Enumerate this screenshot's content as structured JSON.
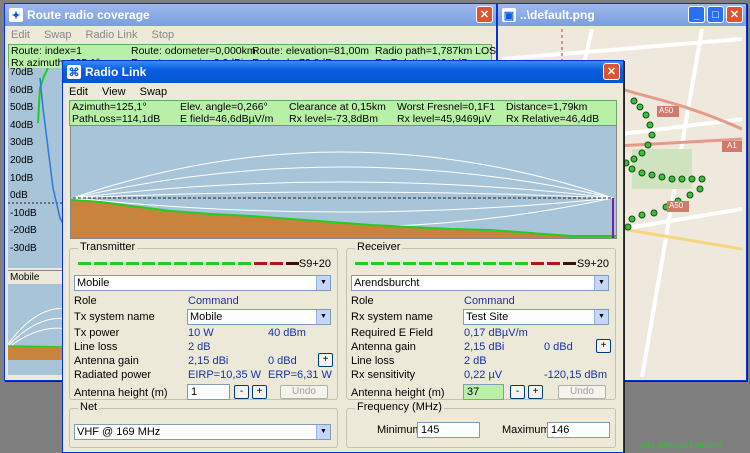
{
  "route_window": {
    "title": "Route radio coverage",
    "menu": [
      "Edit",
      "Swap",
      "Radio Link",
      "Stop"
    ],
    "info_row1": [
      "Route: index=1",
      "Route: odometer=0,000km",
      "Route: elevation=81,00m",
      "Radio path=1,787km LOS"
    ],
    "info_row2": [
      "Rx azimuth=305,1°",
      "Rx antenna gain=2,2dBi",
      "Rx level=-73,8dBm",
      "Rx Relative=46,4dB"
    ],
    "y_ticks": [
      "70dB",
      "60dB",
      "50dB",
      "40dB",
      "30dB",
      "20dB",
      "10dB",
      "0dB",
      "-10dB",
      "-20dB",
      "-30dB"
    ],
    "mobile_label": "Mobile"
  },
  "map_window": {
    "title": "..\\default.png",
    "road_labels": [
      "A50",
      "A1",
      "A50"
    ],
    "credit": "(cc) www.pe1mew.nl"
  },
  "radio_link": {
    "title": "Radio Link",
    "menu": [
      "Edit",
      "View",
      "Swap"
    ],
    "info_row1": [
      "Azimuth=125,1°",
      "Elev. angle=0,266°",
      "Clearance at 0,15km",
      "Worst Fresnel=0,1F1",
      "Distance=1,79km"
    ],
    "info_row2": [
      "PathLoss=114,1dB",
      "E field=46,6dBµV/m",
      "Rx level=-73,8dBm",
      "Rx level=45,9469µV",
      "Rx Relative=46,4dB"
    ],
    "transmitter": {
      "title": "Transmitter",
      "meter_label": "S9+20",
      "station": "Mobile",
      "rows": [
        {
          "label": "Role",
          "v1": "Command",
          "v2": ""
        },
        {
          "label": "Tx system name",
          "v1": "Mobile",
          "v2": ""
        },
        {
          "label": "Tx power",
          "v1": "10 W",
          "v2": "40 dBm"
        },
        {
          "label": "Line loss",
          "v1": "2 dB",
          "v2": ""
        },
        {
          "label": "Antenna gain",
          "v1": "2,15 dBi",
          "v2": "0 dBd"
        },
        {
          "label": "Radiated power",
          "v1": "EIRP=10,35 W",
          "v2": "ERP=6,31 W"
        },
        {
          "label": "Antenna height (m)",
          "v1": "1",
          "v2": ""
        }
      ],
      "undo": "Undo"
    },
    "receiver": {
      "title": "Receiver",
      "meter_label": "S9+20",
      "station": "Arendsburcht",
      "rows": [
        {
          "label": "Role",
          "v1": "Command",
          "v2": ""
        },
        {
          "label": "Rx system name",
          "v1": "Test Site",
          "v2": ""
        },
        {
          "label": "Required E Field",
          "v1": "0,17 dBµV/m",
          "v2": ""
        },
        {
          "label": "Antenna gain",
          "v1": "2,15 dBi",
          "v2": "0 dBd"
        },
        {
          "label": "Line loss",
          "v1": "2 dB",
          "v2": ""
        },
        {
          "label": "Rx sensitivity",
          "v1": "0,22 µV",
          "v2": "-120,15 dBm"
        },
        {
          "label": "Antenna height (m)",
          "v1": "37",
          "v2": ""
        }
      ],
      "undo": "Undo"
    },
    "net": {
      "title": "Net",
      "value": "VHF @ 169 MHz"
    },
    "frequency": {
      "title": "Frequency (MHz)",
      "min_label": "Minimum",
      "min_value": "145",
      "max_label": "Maximum",
      "max_value": "146"
    },
    "plus": "+",
    "minus": "-"
  },
  "colors": {
    "terrain": "#c8843c",
    "sky": "#a8c4d8",
    "green": "#22cc22",
    "meter_green": "#22cc22",
    "meter_red": "#b01818"
  }
}
